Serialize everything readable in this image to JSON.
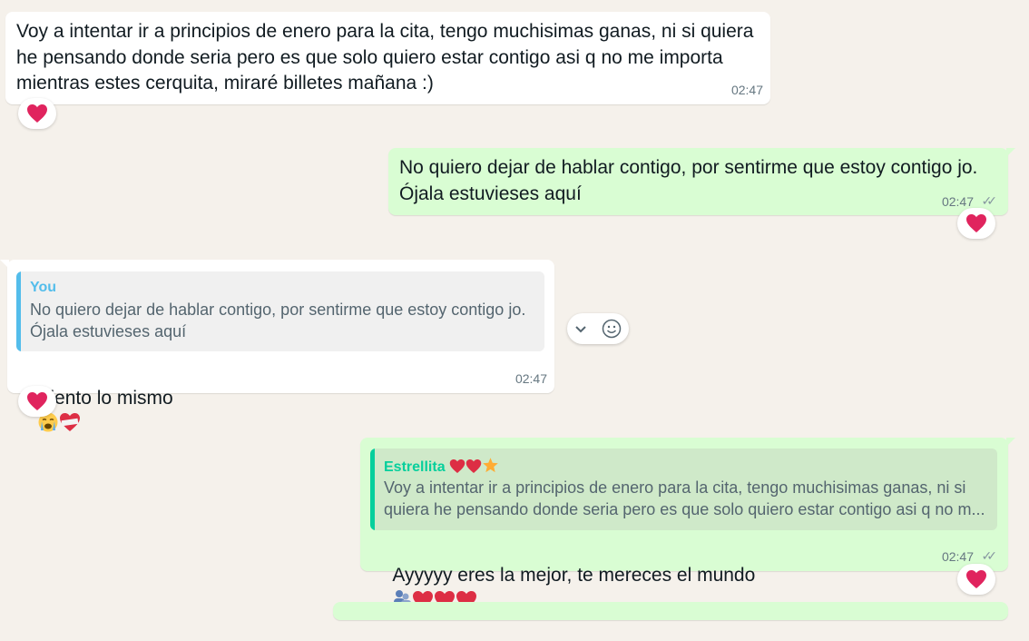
{
  "messages": [
    {
      "id": "m1",
      "direction": "incoming",
      "text": "Voy a intentar ir a principios de enero para la cita, tengo muchisimas ganas, ni si quiera\nhe pensando donde seria pero es que solo quiero estar contigo asi q no me importa\nmientras estes cerquita, miraré billetes mañana :)",
      "time": "02:47",
      "reaction": "heart"
    },
    {
      "id": "m2",
      "direction": "outgoing",
      "text": "No quiero dejar de hablar contigo, por sentirme que estoy contigo jo.\nÓjala estuvieses aquí",
      "time": "02:47",
      "reaction": "heart"
    },
    {
      "id": "m3",
      "direction": "incoming",
      "quote": {
        "author": "You",
        "text": "No quiero dejar de hablar contigo, por sentirme que estoy contigo jo.\nÓjala estuvieses aquí"
      },
      "text": "Siento lo mismo",
      "emojis": [
        "crying-face",
        "mending-heart"
      ],
      "time": "02:47",
      "reaction": "heart"
    },
    {
      "id": "m4",
      "direction": "outgoing",
      "quote": {
        "author": "Estrellita",
        "author_emojis": [
          "red-heart",
          "red-heart",
          "star"
        ],
        "text": "Voy a intentar ir a principios de enero para la cita, tengo muchisimas ganas, ni si\nquiera he pensando donde seria pero es que solo quiero estar contigo asi q no m..."
      },
      "text": "Ayyyyy eres la mejor, te mereces el mundo",
      "emojis": [
        "globe-people",
        "red-heart",
        "red-heart",
        "red-heart"
      ],
      "time": "02:47",
      "reaction": "heart"
    }
  ],
  "icons": {
    "read_receipt": "double-check-icon",
    "menu": "chevron-down-icon",
    "react": "smiley-icon"
  },
  "colors": {
    "chat_background": "#f5f1eb",
    "incoming_bubble": "#ffffff",
    "outgoing_bubble": "#d9fdd3",
    "quote_you": "#53bdeb",
    "quote_estrellita": "#06cf9c",
    "heart": "#e0245e"
  }
}
